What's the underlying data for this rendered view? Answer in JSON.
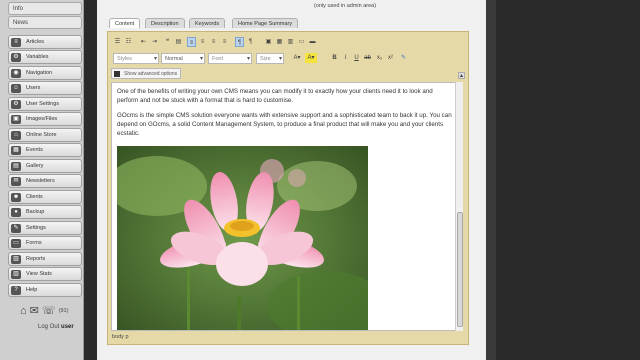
{
  "sidebar": {
    "top_links": [
      "Info",
      "News"
    ],
    "items": [
      {
        "label": "Articles",
        "icon": "articles-icon",
        "glyph": "≡"
      },
      {
        "label": "Variables",
        "icon": "variables-icon",
        "glyph": "⚙"
      },
      {
        "label": "Navigation",
        "icon": "navigation-icon",
        "glyph": "◉"
      },
      {
        "label": "Users",
        "icon": "users-icon",
        "glyph": "☺"
      },
      {
        "label": "User Settings",
        "icon": "user-settings-icon",
        "glyph": "⚙"
      },
      {
        "label": "Images/Files",
        "icon": "images-files-icon",
        "glyph": "▣"
      },
      {
        "label": "Online Store",
        "icon": "online-store-icon",
        "glyph": "⌂"
      },
      {
        "label": "Events",
        "icon": "events-icon",
        "glyph": "▦"
      },
      {
        "label": "Gallery",
        "icon": "gallery-icon",
        "glyph": "▤"
      },
      {
        "label": "Newsletters",
        "icon": "newsletters-icon",
        "glyph": "✉"
      },
      {
        "label": "Clients",
        "icon": "clients-icon",
        "glyph": "☻"
      },
      {
        "label": "Backup",
        "icon": "backup-icon",
        "glyph": "●"
      },
      {
        "label": "Settings",
        "icon": "settings-icon",
        "glyph": "✎"
      },
      {
        "label": "Forms",
        "icon": "forms-icon",
        "glyph": "▭"
      },
      {
        "label": "Reports",
        "icon": "reports-icon",
        "glyph": "▥"
      },
      {
        "label": "View Stats",
        "icon": "view-stats-icon",
        "glyph": "▥"
      },
      {
        "label": "Help",
        "icon": "help-icon",
        "glyph": "?"
      }
    ],
    "message_count": "(91)",
    "logout_label": "Log Out",
    "logout_user": "user"
  },
  "main": {
    "admin_note": "(only used in admin area)",
    "tabs": [
      "Content",
      "Description",
      "Keywords",
      "Home Page Summary"
    ],
    "active_tab": "Content"
  },
  "editor": {
    "styles_placeholder": "Styles",
    "format_value": "Normal",
    "font_placeholder": "Font",
    "size_placeholder": "Size",
    "advanced_label": "Show advanced options",
    "paragraph_1": "One of the benefits of writing your own CMS means you can modify it to exactly how your clients need it to look and perform and not be stuck with a format that is hard to customise.",
    "paragraph_2": "GOcms is the simple CMS solution everyone wants with extensive support and a sophisticated team to back it up.  You can depend on GOcms, a solid Content Management System, to produce a final product that will make you and your clients ecstatic.",
    "element_path": "body  p"
  },
  "colors": {
    "editor_frame": "#e6d9a8",
    "sidebar_bg": "#cfcfcf",
    "gutter": "#2a2a2a"
  }
}
